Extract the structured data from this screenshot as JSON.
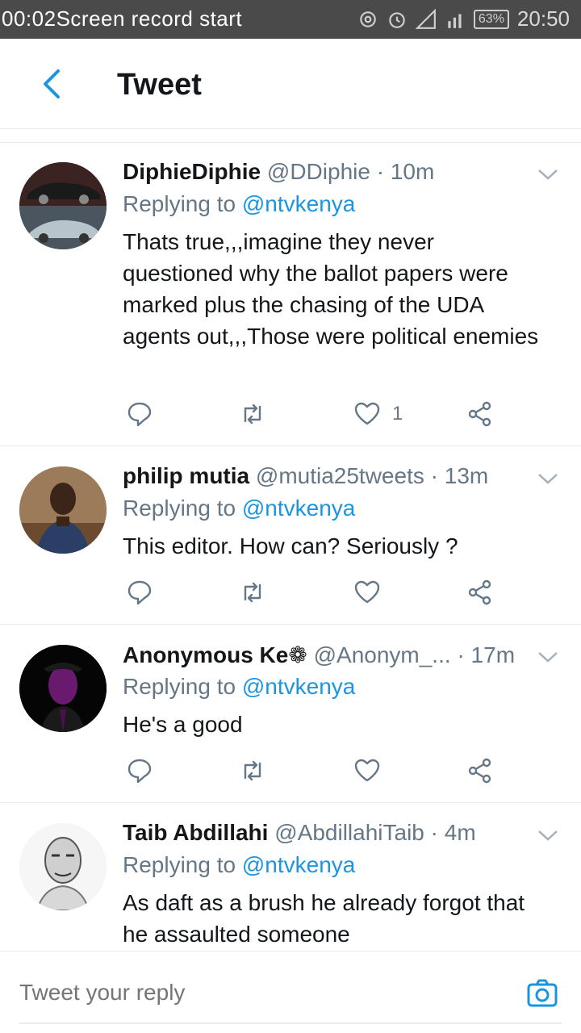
{
  "status_bar": {
    "recording": "00:02Screen record start",
    "battery": "63%",
    "time": "20:50"
  },
  "header": {
    "back_icon": "chevron-left-icon",
    "title": "Tweet"
  },
  "colors": {
    "accent": "#1b95e0",
    "secondary_text": "#657786",
    "divider": "#e6ecf0",
    "status_bar": "#4a4a4a"
  },
  "tweets": [
    {
      "name": "DiphieDiphie",
      "handle": "@DDiphie",
      "dot": "·",
      "time": "10m",
      "replying_prefix": "Replying to",
      "replying_to": "@ntvkenya",
      "text": "Thats true,,,imagine they never questioned why the ballot papers were marked plus the chasing of the UDA agents out,,,Those were political enemies",
      "like_count": "1"
    },
    {
      "name": "philip mutia",
      "handle": "@mutia25tweets",
      "dot": "·",
      "time": "13m",
      "replying_prefix": "Replying to",
      "replying_to": "@ntvkenya",
      "text": "This editor. How can? Seriously ?",
      "like_count": ""
    },
    {
      "name": "Anonymous Ke❁",
      "handle": "@Anonym_...",
      "dot": "·",
      "time": "17m",
      "replying_prefix": "Replying to",
      "replying_to": "@ntvkenya",
      "text": "He's a good",
      "like_count": ""
    },
    {
      "name": "Taib Abdillahi",
      "handle": "@AbdillahiTaib",
      "dot": "·",
      "time": "4m",
      "replying_prefix": "Replying to",
      "replying_to": "@ntvkenya",
      "text": "As daft as a brush he already forgot that he assaulted someone",
      "like_count": ""
    }
  ],
  "reply_bar": {
    "placeholder": "Tweet your reply",
    "camera_icon": "camera-icon"
  }
}
